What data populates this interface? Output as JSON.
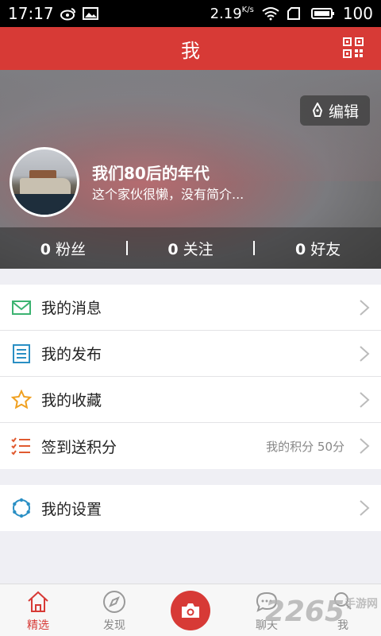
{
  "status_bar": {
    "time": "17:17",
    "speed": "2.19",
    "speed_unit": "K/s",
    "battery": "100"
  },
  "header": {
    "title": "我"
  },
  "profile": {
    "edit_label": "编辑",
    "name": "我们80后的年代",
    "bio": "这个家伙很懒，没有简介...",
    "stats": [
      {
        "count": "0",
        "label": "粉丝"
      },
      {
        "count": "0",
        "label": "关注"
      },
      {
        "count": "0",
        "label": "好友"
      }
    ]
  },
  "menu": {
    "group1": [
      {
        "label": "我的消息",
        "icon": "mail-icon",
        "color": "#3cb371"
      },
      {
        "label": "我的发布",
        "icon": "list-icon",
        "color": "#2a8fc4"
      },
      {
        "label": "我的收藏",
        "icon": "star-icon",
        "color": "#f0a020"
      },
      {
        "label": "签到送积分",
        "icon": "checklist-icon",
        "color": "#e05a30",
        "extra": "我的积分 50分"
      }
    ],
    "group2": [
      {
        "label": "我的设置",
        "icon": "gear-icon",
        "color": "#2a8fc4"
      }
    ]
  },
  "tabbar": {
    "tabs": [
      {
        "label": "精选",
        "icon": "home-icon"
      },
      {
        "label": "发现",
        "icon": "compass-icon"
      },
      {
        "label": "",
        "icon": "camera-icon"
      },
      {
        "label": "聊天",
        "icon": "chat-icon"
      },
      {
        "label": "我",
        "icon": "search-icon"
      }
    ]
  },
  "watermark": {
    "text": "2265",
    "sub": "手游网"
  },
  "colors": {
    "accent": "#d73a36"
  }
}
